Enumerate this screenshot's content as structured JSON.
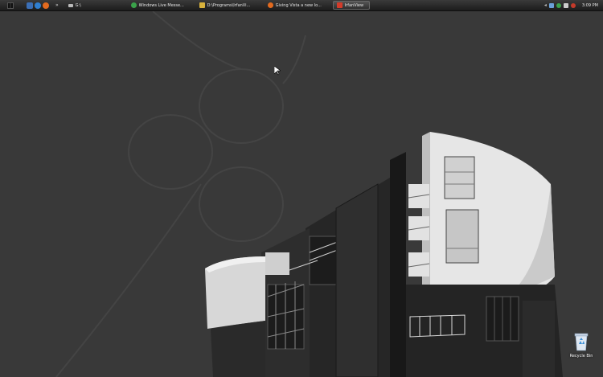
{
  "taskbar": {
    "quick_launch": [
      {
        "icon": "show-desktop-icon",
        "color": "#3b6fb6"
      },
      {
        "icon": "internet-explorer-icon",
        "color": "#2f7fd0"
      },
      {
        "icon": "firefox-icon",
        "color": "#e26a1f"
      }
    ],
    "overflow_label": "»",
    "drive_label": "G:\\",
    "tasks": [
      {
        "label": "Windows Live Messe...",
        "icon": "messenger-icon",
        "color": "#3aa24a",
        "active": false
      },
      {
        "label": "D:\\Programs\\IrfanVi...",
        "icon": "folder-icon",
        "color": "#d8b23c",
        "active": false
      },
      {
        "label": "Giving Vista a new lo...",
        "icon": "firefox-icon",
        "color": "#e26a1f",
        "active": false
      },
      {
        "label": "IrfanView",
        "icon": "irfanview-icon",
        "color": "#d23b2a",
        "active": true
      }
    ],
    "tray_icons": [
      {
        "icon": "chevron-left-icon",
        "color": "#bbbbbb"
      },
      {
        "icon": "network-icon",
        "color": "#6aa0d8"
      },
      {
        "icon": "messenger-tray-icon",
        "color": "#3aa24a"
      },
      {
        "icon": "volume-icon",
        "color": "#cccccc"
      },
      {
        "icon": "security-icon",
        "color": "#c33a2a"
      }
    ],
    "clock": "3:09 PM"
  },
  "desktop": {
    "recycle_bin_label": "Recycle Bin"
  }
}
